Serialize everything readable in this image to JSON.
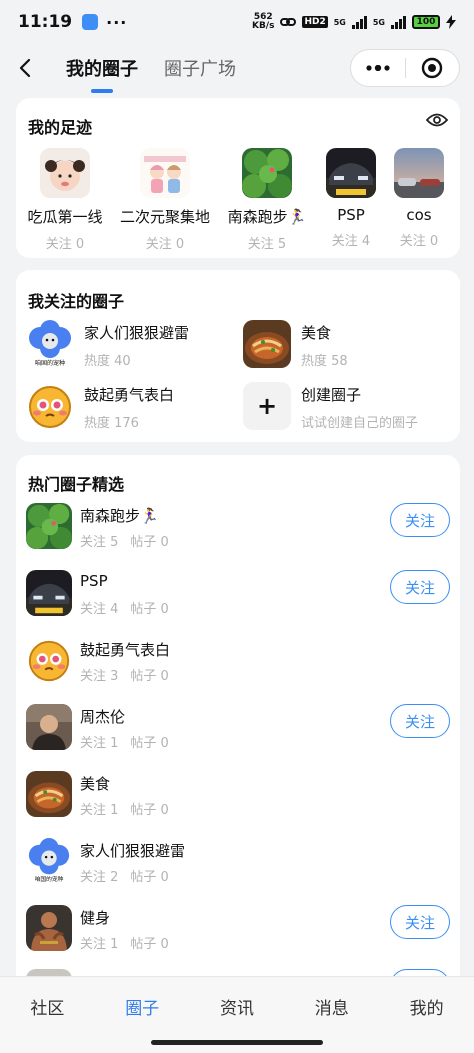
{
  "status_bar": {
    "time": "11:19",
    "net_speed_top": "562",
    "net_speed_bottom": "KB/s",
    "hd_badge": "HD2",
    "sig1_label": "5G",
    "sig2_label": "5G",
    "battery": "100"
  },
  "nav": {
    "tab_mine": "我的圈子",
    "tab_square": "圈子广场"
  },
  "footprints": {
    "title": "我的足迹",
    "items": [
      {
        "name": "吃瓜第一线",
        "meta": "关注 0"
      },
      {
        "name": "二次元聚集地",
        "meta": "关注 0"
      },
      {
        "name": "南森跑步🏃‍♀️",
        "meta": "关注 5"
      },
      {
        "name": "PSP",
        "meta": "关注 4"
      },
      {
        "name": "cos",
        "meta": "关注 0"
      }
    ]
  },
  "followed": {
    "title": "我关注的圈子",
    "items": [
      {
        "name": "家人们狠狠避雷",
        "meta": "热度 40",
        "img_caption": "咱国的宠种"
      },
      {
        "name": "美食",
        "meta": "热度 58"
      },
      {
        "name": "鼓起勇气表白",
        "meta": "热度 176"
      },
      {
        "name": "创建圈子",
        "meta": "试试创建自己的圈子",
        "plus": "+"
      }
    ]
  },
  "hot": {
    "title": "热门圈子精选",
    "follow_label": "关注",
    "items": [
      {
        "name": "南森跑步🏃‍♀️",
        "follow": "关注 5",
        "posts": "帖子 0",
        "has_button": true
      },
      {
        "name": "PSP",
        "follow": "关注 4",
        "posts": "帖子 0",
        "has_button": true
      },
      {
        "name": "鼓起勇气表白",
        "follow": "关注 3",
        "posts": "帖子 0",
        "has_button": false
      },
      {
        "name": "周杰伦",
        "follow": "关注 1",
        "posts": "帖子 0",
        "has_button": true
      },
      {
        "name": "美食",
        "follow": "关注 1",
        "posts": "帖子 0",
        "has_button": false
      },
      {
        "name": "家人们狠狠避雷",
        "follow": "关注 2",
        "posts": "帖子 0",
        "has_button": false,
        "img_caption": "咱国的宠种"
      },
      {
        "name": "健身",
        "follow": "关注 1",
        "posts": "帖子 0",
        "has_button": true
      }
    ]
  },
  "tabbar": {
    "items": [
      "社区",
      "圈子",
      "资讯",
      "消息",
      "我的"
    ],
    "active": "圈子"
  },
  "colors": {
    "accent": "#2f7bf0",
    "follow_button": "#3a8ff5",
    "muted_text": "#b3b3b3",
    "background": "#f2f3f5"
  }
}
